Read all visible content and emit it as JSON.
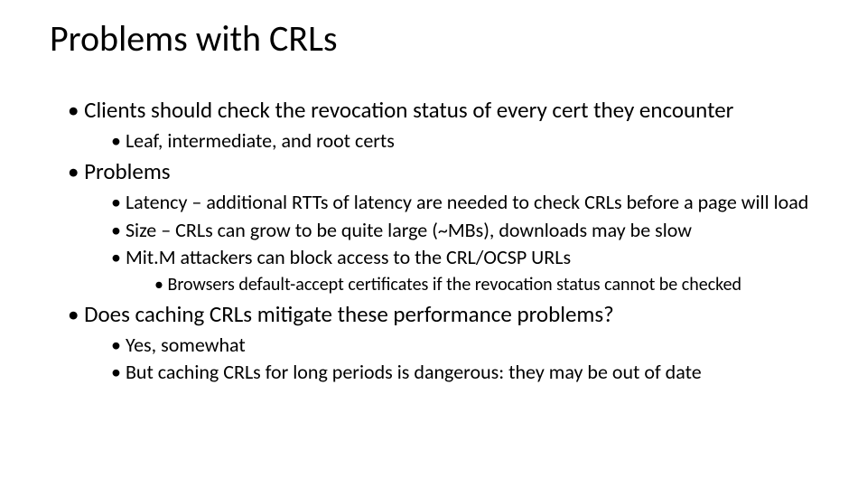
{
  "slide": {
    "title": "Problems with CRLs",
    "bullets": {
      "b1": "Clients should check the revocation status of every cert they encounter",
      "b1_1": "Leaf, intermediate, and root certs",
      "b2": "Problems",
      "b2_1": "Latency – additional RTTs of latency are needed to check CRLs before a page will load",
      "b2_2": "Size – CRLs can grow to be quite large (~MBs), downloads may be slow",
      "b2_3": "Mit.M attackers can block access to the CRL/OCSP URLs",
      "b2_3_1": "Browsers default-accept certificates if the revocation status cannot be checked",
      "b3": "Does caching CRLs mitigate these performance problems?",
      "b3_1": "Yes, somewhat",
      "b3_2": "But caching CRLs for long periods is dangerous: they may be out of date"
    }
  }
}
